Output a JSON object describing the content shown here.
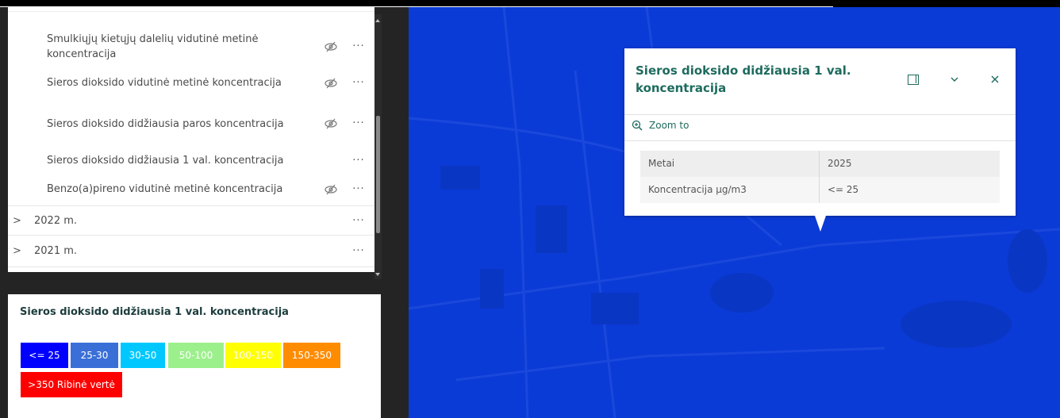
{
  "layers": {
    "items": [
      {
        "label": "Smulkiųjų kietųjų dalelių vidutinė metinė koncentracija",
        "hidden": true
      },
      {
        "label": "Sieros dioksido vidutinė metinė koncentracija",
        "hidden": true
      },
      {
        "label": "Sieros dioksido didžiausia paros koncentracija",
        "hidden": true
      },
      {
        "label": "Sieros dioksido didžiausia 1 val. koncentracija",
        "hidden": false
      },
      {
        "label": "Benzo(a)pireno vidutinė metinė koncentracija",
        "hidden": true
      }
    ],
    "groups": [
      {
        "label": "2022 m."
      },
      {
        "label": "2021 m."
      }
    ],
    "more_symbol": "···",
    "chevron_symbol": ">"
  },
  "legend": {
    "title": "Sieros dioksido didžiausia 1 val. koncentracija",
    "swatches": [
      {
        "label": "<= 25",
        "color": "#0000ff"
      },
      {
        "label": "25-30",
        "color": "#3a6fd8"
      },
      {
        "label": "30-50",
        "color": "#00c8ff"
      },
      {
        "label": "50-100",
        "color": "#9cf08c"
      },
      {
        "label": "100-150",
        "color": "#ffff00"
      },
      {
        "label": "150-350",
        "color": "#ff8c00"
      },
      {
        "label": ">350 Ribinė vertė",
        "color": "#ff0000"
      }
    ]
  },
  "popup": {
    "title": "Sieros dioksido didžiausia 1 val. koncentracija",
    "zoom_label": "Zoom to",
    "rows": [
      {
        "key": "Metai",
        "value": "2025"
      },
      {
        "key": "Koncentracija µg/m3",
        "value": "<= 25"
      }
    ]
  },
  "colors": {
    "map_background": "#0b3bd6",
    "popup_title": "#1e6b5e"
  }
}
